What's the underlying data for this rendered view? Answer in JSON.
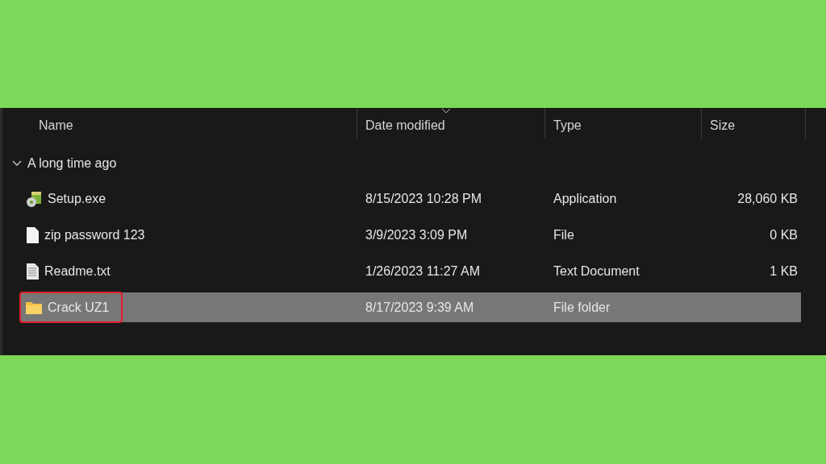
{
  "columns": [
    {
      "label": "Name",
      "sorted": false
    },
    {
      "label": "Date modified",
      "sorted": true
    },
    {
      "label": "Type",
      "sorted": false
    },
    {
      "label": "Size",
      "sorted": false
    }
  ],
  "group": {
    "label": "A long time ago",
    "expanded": true
  },
  "rows": [
    {
      "kind": "setup",
      "name": "Setup.exe",
      "date": "8/15/2023 10:28 PM",
      "type": "Application",
      "size": "28,060 KB",
      "selected": false,
      "outlined": false
    },
    {
      "kind": "file",
      "name": "zip password 123",
      "date": "3/9/2023 3:09 PM",
      "type": "File",
      "size": "0 KB",
      "selected": false,
      "outlined": false
    },
    {
      "kind": "text",
      "name": "Readme.txt",
      "date": "1/26/2023 11:27 AM",
      "type": "Text Document",
      "size": "1 KB",
      "selected": false,
      "outlined": false
    },
    {
      "kind": "folder",
      "name": "Crack UZ1",
      "date": "8/17/2023 9:39 AM",
      "type": "File folder",
      "selected": true,
      "outlined": true
    }
  ]
}
